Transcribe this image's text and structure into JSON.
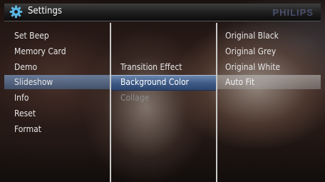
{
  "header": {
    "title": "Settings",
    "brand": "PHILIPS",
    "icon": "gear-icon"
  },
  "menu": {
    "main": [
      {
        "label": "Set Beep"
      },
      {
        "label": "Memory Card"
      },
      {
        "label": "Demo"
      },
      {
        "label": "Slideshow",
        "selected": true
      },
      {
        "label": "Info"
      },
      {
        "label": "Reset"
      },
      {
        "label": "Format"
      }
    ],
    "submenu": [
      {
        "label": "Transition Effect"
      },
      {
        "label": "Background Color",
        "selected": true
      },
      {
        "label": "Collage"
      }
    ],
    "options": [
      {
        "label": "Original Black"
      },
      {
        "label": "Original Grey"
      },
      {
        "label": "Original White"
      },
      {
        "label": "Auto Fit",
        "selected": true
      }
    ]
  },
  "colors": {
    "selection": "#3d5a86",
    "text": "#e6e6e6",
    "divider": "#c9c9c9"
  }
}
